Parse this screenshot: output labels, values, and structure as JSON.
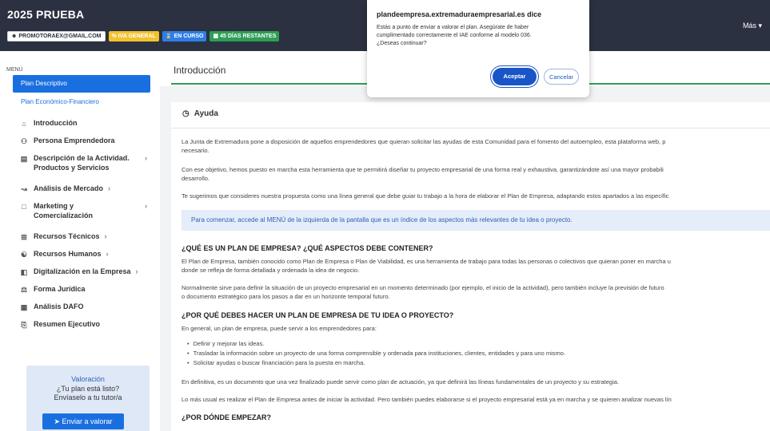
{
  "header": {
    "plan_title": "2025 PRUEBA",
    "badges": {
      "email": "PROMOTORAEX@GMAIL.COM",
      "iva": "IVA GENERAL",
      "status": "EN CURSO",
      "days": "45 DÍAS RESTANTES"
    },
    "more": "Más"
  },
  "sidebar": {
    "menu_label": "MENÚ",
    "plan_descriptivo": "Plan Descriptivo",
    "plan_economico": "Plan Económico-Financiero",
    "items": [
      {
        "label": "Introducción",
        "icon": "home-icon"
      },
      {
        "label": "Persona Emprendedora",
        "icon": "people-icon"
      },
      {
        "label": "Descripción de la Actividad. Productos y Servicios",
        "icon": "store-icon"
      },
      {
        "label": "Análisis de Mercado",
        "icon": "chart-icon"
      },
      {
        "label": "Marketing y Comercialización",
        "icon": "bag-icon"
      },
      {
        "label": "Recursos Técnicos",
        "icon": "tools-icon"
      },
      {
        "label": "Recursos Humanos",
        "icon": "group-icon"
      },
      {
        "label": "Digitalización en la Empresa",
        "icon": "digital-icon"
      },
      {
        "label": "Forma Jurídica",
        "icon": "scale-icon"
      },
      {
        "label": "Análisis DAFO",
        "icon": "dafo-icon"
      },
      {
        "label": "Resumen Ejecutivo",
        "icon": "summary-icon"
      }
    ],
    "valoracion": {
      "title": "Valoración",
      "question": "¿Tu plan está listo?",
      "send_text": "Envíaselo a tu tutor/a",
      "button": "Enviar a valorar"
    }
  },
  "main": {
    "section_title": "Introducción",
    "help_title": "Ayuda",
    "p1a": "La Junta de Extremadura pone a disposición de aquellos emprendedores que quieran solicitar las ayudas de esta Comunidad para el fomento del autoempleo, esta plataforma web, p",
    "p1b": "necesario.",
    "p2a": "Con ese objetivo, hemos puesto en marcha esta herramienta que te permitirá diseñar tu proyecto empresarial de una forma real y exhaustiva, garantizándote así una mayor probabili",
    "p2b": "desarrollo.",
    "p3": "Te sugerimos que consideres nuestra propuesta como una línea general que debe guiar tu trabajo a la hora de elaborar el Plan de Empresa, adaptando estos apartados a las específic",
    "callout": "Para comenzar, accede al MENÚ de la izquierda de la pantalla que es un índice de los aspectos más relevantes de tu idea o proyecto.",
    "h1": "¿QUÉ ES UN PLAN DE EMPRESA? ¿QUÉ ASPECTOS DEBE CONTENER?",
    "p4a": "El Plan de Empresa, también conocido como Plan de Empresa o Plan de Viabilidad, es una herramienta de trabajo para todas las personas o colectivos que quieran poner en marcha u",
    "p4b": "donde se refleja de forma detallada y ordenada la idea de negocio.",
    "p5a": "Normalmente sirve para definir la situación de un proyecto empresarial en un momento determinado (por ejemplo, el inicio de la actividad), pero también incluye la previsión de futuro",
    "p5b": "o documento estratégico para los pasos a dar en un horizonte temporal futuro.",
    "h2": "¿POR QUÉ DEBES HACER UN PLAN DE EMPRESA DE TU IDEA O PROYECTO?",
    "p6": "En general, un plan de empresa, puede servir a los emprendedores para:",
    "bullets": [
      "Definir y mejorar las ideas.",
      "Trasladar la información sobre un proyecto de una forma comprensible y ordenada para instituciones, clientes, entidades y para uno mismo.",
      "Solicitar ayudas o buscar financiación para la puesta en marcha."
    ],
    "p7": "En definitiva, es un documento que una vez finalizado puede servir como plan de actuación, ya que definirá las líneas fundamentales de un proyecto y su estrategia.",
    "p8": "Lo más usual es realizar el Plan de Empresa antes de iniciar la actividad. Pero también puedes elaborarse si el proyecto empresarial está ya en marcha y se quieren analizar nuevas lín",
    "h3": "¿POR DÓNDE EMPEZAR?"
  },
  "dialog": {
    "title": "plandeempresa.extremaduraempresarial.es dice",
    "message_lines": [
      "Estás a punto de enviar a valorar el plan. Asegúrate de haber",
      "cumplimentado correctamente el IAE conforme al modelo 036.",
      "¿Deseas continuar?"
    ],
    "accept": "Aceptar",
    "cancel": "Cancelar"
  }
}
